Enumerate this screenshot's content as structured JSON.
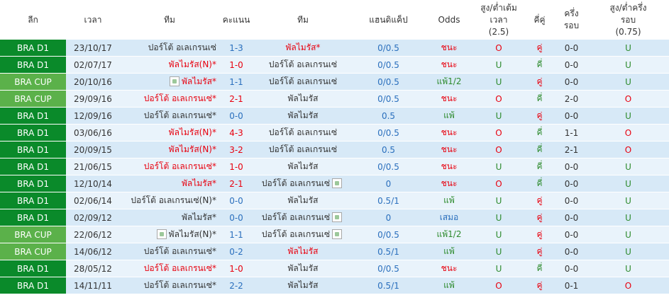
{
  "headers": {
    "league": "ลีก",
    "time": "เวลา",
    "home": "ทีม",
    "score": "คะแนน",
    "away": "ทีม",
    "handicap": "แฮนดิแค็ป",
    "odds": "Odds",
    "ou_line1": "สูง/ต่ำเต้ม",
    "ou_line2": "เวลา",
    "ou_line3": "(2.5)",
    "oe": "คี่คู่",
    "ht_line1": "ครึ่ง",
    "ht_line2": "รอบ",
    "htou_line1": "สูง/ต่ำครึ่ง",
    "htou_line2": "รอบ",
    "htou_line3": "(0.75)"
  },
  "icons": {
    "team_logo": "team-logo-icon"
  },
  "colors": {
    "win": "#e8000e",
    "lose": "#2e8b2e",
    "draw": "#2a6fbd",
    "league_d1": "#0a8a2a",
    "league_cup": "#5bb14a",
    "row": "#d7e9f7",
    "row_alt": "#e9f3fb"
  },
  "matches": [
    {
      "league": "BRA D1",
      "league_type": "d1",
      "date": "23/10/17",
      "home": "ปอร์โต้ อเลเกรนเซ่",
      "home_color": "dark",
      "home_img": false,
      "score": "1-3",
      "score_color": "blue",
      "away": "พัลไมรัส*",
      "away_color": "red",
      "away_img": false,
      "handicap": "0/0.5",
      "result": "ชนะ",
      "result_color": "red",
      "ou": "O",
      "ou_color": "red",
      "oe": "คู่",
      "oe_color": "red",
      "ht": "0-0",
      "htou": "U",
      "htou_color": "green"
    },
    {
      "league": "BRA D1",
      "league_type": "d1",
      "date": "02/07/17",
      "home": "พัลไมรัส(N)*",
      "home_color": "red",
      "home_img": false,
      "score": "1-0",
      "score_color": "red",
      "away": "ปอร์โต้ อเลเกรนเซ่",
      "away_color": "dark",
      "away_img": false,
      "handicap": "0/0.5",
      "result": "ชนะ",
      "result_color": "red",
      "ou": "U",
      "ou_color": "green",
      "oe": "คี่",
      "oe_color": "green",
      "ht": "0-0",
      "htou": "U",
      "htou_color": "green"
    },
    {
      "league": "BRA CUP",
      "league_type": "cup",
      "date": "20/10/16",
      "home": "พัลไมรัส*",
      "home_color": "red",
      "home_img": true,
      "score": "1-1",
      "score_color": "blue",
      "away": "ปอร์โต้ อเลเกรนเซ่",
      "away_color": "dark",
      "away_img": false,
      "handicap": "0/0.5",
      "result": "แพ้1/2",
      "result_color": "green",
      "ou": "U",
      "ou_color": "green",
      "oe": "คู่",
      "oe_color": "red",
      "ht": "0-0",
      "htou": "U",
      "htou_color": "green"
    },
    {
      "league": "BRA CUP",
      "league_type": "cup",
      "date": "29/09/16",
      "home": "ปอร์โต้ อเลเกรนเซ่*",
      "home_color": "red",
      "home_img": false,
      "score": "2-1",
      "score_color": "red",
      "away": "พัลไมรัส",
      "away_color": "dark",
      "away_img": false,
      "handicap": "0/0.5",
      "result": "ชนะ",
      "result_color": "red",
      "ou": "O",
      "ou_color": "red",
      "oe": "คี่",
      "oe_color": "green",
      "ht": "2-0",
      "htou": "O",
      "htou_color": "red"
    },
    {
      "league": "BRA D1",
      "league_type": "d1",
      "date": "12/09/16",
      "home": "ปอร์โต้ อเลเกรนเซ่*",
      "home_color": "dark",
      "home_img": false,
      "score": "0-0",
      "score_color": "blue",
      "away": "พัลไมรัส",
      "away_color": "dark",
      "away_img": false,
      "handicap": "0.5",
      "result": "แพ้",
      "result_color": "green",
      "ou": "U",
      "ou_color": "green",
      "oe": "คู่",
      "oe_color": "red",
      "ht": "0-0",
      "htou": "U",
      "htou_color": "green"
    },
    {
      "league": "BRA D1",
      "league_type": "d1",
      "date": "03/06/16",
      "home": "พัลไมรัส(N)*",
      "home_color": "red",
      "home_img": false,
      "score": "4-3",
      "score_color": "red",
      "away": "ปอร์โต้ อเลเกรนเซ่",
      "away_color": "dark",
      "away_img": false,
      "handicap": "0/0.5",
      "result": "ชนะ",
      "result_color": "red",
      "ou": "O",
      "ou_color": "red",
      "oe": "คี่",
      "oe_color": "green",
      "ht": "1-1",
      "htou": "O",
      "htou_color": "red"
    },
    {
      "league": "BRA D1",
      "league_type": "d1",
      "date": "20/09/15",
      "home": "พัลไมรัส(N)*",
      "home_color": "red",
      "home_img": false,
      "score": "3-2",
      "score_color": "red",
      "away": "ปอร์โต้ อเลเกรนเซ่",
      "away_color": "dark",
      "away_img": false,
      "handicap": "0.5",
      "result": "ชนะ",
      "result_color": "red",
      "ou": "O",
      "ou_color": "red",
      "oe": "คี่",
      "oe_color": "green",
      "ht": "2-1",
      "htou": "O",
      "htou_color": "red"
    },
    {
      "league": "BRA D1",
      "league_type": "d1",
      "date": "21/06/15",
      "home": "ปอร์โต้ อเลเกรนเซ่*",
      "home_color": "red",
      "home_img": false,
      "score": "1-0",
      "score_color": "red",
      "away": "พัลไมรัส",
      "away_color": "dark",
      "away_img": false,
      "handicap": "0/0.5",
      "result": "ชนะ",
      "result_color": "red",
      "ou": "U",
      "ou_color": "green",
      "oe": "คี่",
      "oe_color": "green",
      "ht": "0-0",
      "htou": "U",
      "htou_color": "green"
    },
    {
      "league": "BRA D1",
      "league_type": "d1",
      "date": "12/10/14",
      "home": "พัลไมรัส*",
      "home_color": "red",
      "home_img": false,
      "score": "2-1",
      "score_color": "red",
      "away": "ปอร์โต้ อเลเกรนเซ่",
      "away_color": "dark",
      "away_img": true,
      "handicap": "0",
      "result": "ชนะ",
      "result_color": "red",
      "ou": "O",
      "ou_color": "red",
      "oe": "คี่",
      "oe_color": "green",
      "ht": "0-0",
      "htou": "U",
      "htou_color": "green"
    },
    {
      "league": "BRA D1",
      "league_type": "d1",
      "date": "02/06/14",
      "home": "ปอร์โต้ อเลเกรนเซ่(N)*",
      "home_color": "dark",
      "home_img": false,
      "score": "0-0",
      "score_color": "blue",
      "away": "พัลไมรัส",
      "away_color": "dark",
      "away_img": false,
      "handicap": "0.5/1",
      "result": "แพ้",
      "result_color": "green",
      "ou": "U",
      "ou_color": "green",
      "oe": "คู่",
      "oe_color": "red",
      "ht": "0-0",
      "htou": "U",
      "htou_color": "green"
    },
    {
      "league": "BRA D1",
      "league_type": "d1",
      "date": "02/09/12",
      "home": "พัลไมรัส*",
      "home_color": "dark",
      "home_img": false,
      "score": "0-0",
      "score_color": "blue",
      "away": "ปอร์โต้ อเลเกรนเซ่",
      "away_color": "dark",
      "away_img": true,
      "handicap": "0",
      "result": "เสมอ",
      "result_color": "blue",
      "ou": "U",
      "ou_color": "green",
      "oe": "คู่",
      "oe_color": "red",
      "ht": "0-0",
      "htou": "U",
      "htou_color": "green"
    },
    {
      "league": "BRA CUP",
      "league_type": "cup",
      "date": "22/06/12",
      "home": "พัลไมรัส(N)*",
      "home_color": "dark",
      "home_img": true,
      "score": "1-1",
      "score_color": "blue",
      "away": "ปอร์โต้ อเลเกรนเซ่",
      "away_color": "dark",
      "away_img": true,
      "handicap": "0/0.5",
      "result": "แพ้1/2",
      "result_color": "green",
      "ou": "U",
      "ou_color": "green",
      "oe": "คู่",
      "oe_color": "red",
      "ht": "0-0",
      "htou": "U",
      "htou_color": "green"
    },
    {
      "league": "BRA CUP",
      "league_type": "cup",
      "date": "14/06/12",
      "home": "ปอร์โต้ อเลเกรนเซ่*",
      "home_color": "dark",
      "home_img": false,
      "score": "0-2",
      "score_color": "blue",
      "away": "พัลไมรัส",
      "away_color": "red",
      "away_img": false,
      "handicap": "0.5/1",
      "result": "แพ้",
      "result_color": "green",
      "ou": "U",
      "ou_color": "green",
      "oe": "คู่",
      "oe_color": "red",
      "ht": "0-0",
      "htou": "U",
      "htou_color": "green"
    },
    {
      "league": "BRA D1",
      "league_type": "d1",
      "date": "28/05/12",
      "home": "ปอร์โต้ อเลเกรนเซ่*",
      "home_color": "red",
      "home_img": false,
      "score": "1-0",
      "score_color": "red",
      "away": "พัลไมรัส",
      "away_color": "dark",
      "away_img": false,
      "handicap": "0/0.5",
      "result": "ชนะ",
      "result_color": "red",
      "ou": "U",
      "ou_color": "green",
      "oe": "คี่",
      "oe_color": "green",
      "ht": "0-0",
      "htou": "U",
      "htou_color": "green"
    },
    {
      "league": "BRA D1",
      "league_type": "d1",
      "date": "14/11/11",
      "home": "ปอร์โต้ อเลเกรนเซ่*",
      "home_color": "dark",
      "home_img": false,
      "score": "2-2",
      "score_color": "blue",
      "away": "พัลไมรัส",
      "away_color": "dark",
      "away_img": false,
      "handicap": "0.5/1",
      "result": "แพ้",
      "result_color": "green",
      "ou": "O",
      "ou_color": "red",
      "oe": "คู่",
      "oe_color": "red",
      "ht": "0-1",
      "htou": "O",
      "htou_color": "red"
    }
  ]
}
